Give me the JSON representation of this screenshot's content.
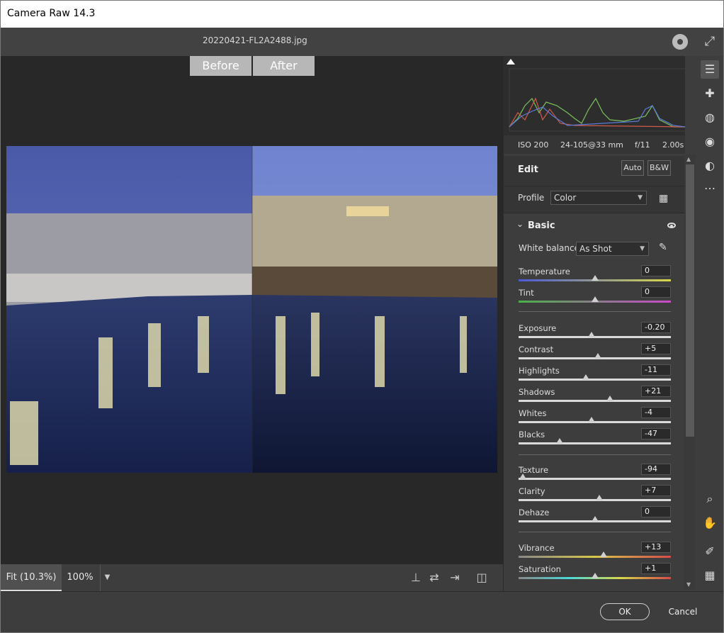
{
  "window": {
    "title": "Camera Raw 14.3"
  },
  "topbar": {
    "filename": "20220421-FL2A2488.jpg",
    "settings_icon": "gear-icon",
    "fullscreen_icon": "expand-icon"
  },
  "preview": {
    "before_label": "Before",
    "after_label": "After"
  },
  "bottombar": {
    "zoom_fit": "Fit (10.3%)",
    "zoom_100": "100%",
    "zoom_dropdown_icon": "chevron-down-icon"
  },
  "caminfo": {
    "iso": "ISO 200",
    "lens": "24-105@33 mm",
    "aperture": "f/11",
    "shutter": "2.00s"
  },
  "edit": {
    "title": "Edit",
    "auto_label": "Auto",
    "bw_label": "B&W"
  },
  "profile": {
    "label": "Profile",
    "value": "Color"
  },
  "basic": {
    "title": "Basic",
    "white_balance_label": "White balance",
    "white_balance_value": "As Shot",
    "temperature": {
      "label": "Temperature",
      "value": "0"
    },
    "tint": {
      "label": "Tint",
      "value": "0"
    },
    "exposure": {
      "label": "Exposure",
      "value": "-0.20"
    },
    "contrast": {
      "label": "Contrast",
      "value": "+5"
    },
    "highlights": {
      "label": "Highlights",
      "value": "-11"
    },
    "shadows": {
      "label": "Shadows",
      "value": "+21"
    },
    "whites": {
      "label": "Whites",
      "value": "-4"
    },
    "blacks": {
      "label": "Blacks",
      "value": "-47"
    },
    "texture": {
      "label": "Texture",
      "value": "-94"
    },
    "clarity": {
      "label": "Clarity",
      "value": "+7"
    },
    "dehaze": {
      "label": "Dehaze",
      "value": "0"
    },
    "vibrance": {
      "label": "Vibrance",
      "value": "+13"
    },
    "saturation": {
      "label": "Saturation",
      "value": "+1"
    }
  },
  "footer": {
    "ok_label": "OK",
    "cancel_label": "Cancel"
  },
  "colors": {
    "accent": "#dddddd",
    "background": "#3d3d3d",
    "preview_bg": "#282828"
  }
}
